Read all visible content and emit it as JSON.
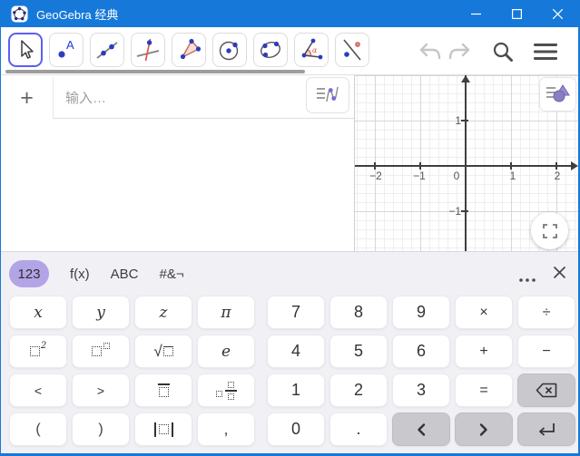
{
  "titlebar": {
    "title": "GeoGebra 经典",
    "icons": [
      "geogebra-logo",
      "minimize",
      "maximize",
      "close"
    ]
  },
  "toolbar": {
    "tools": [
      "move",
      "point",
      "line",
      "perpendicular-line",
      "polygon",
      "circle-with-center",
      "conic-through-points",
      "angle",
      "reflect-about-line"
    ],
    "selected_tool": "move",
    "actions": [
      "undo",
      "redo",
      "search",
      "menu"
    ]
  },
  "algebra": {
    "add_button": "+",
    "input_placeholder": "输入…"
  },
  "graphics": {
    "x_tick_labels": [
      "−2",
      "−1",
      "0",
      "1",
      "2"
    ],
    "y_tick_labels": [
      "1",
      "−1"
    ],
    "buttons": [
      "graphics-style-bar",
      "fullscreen"
    ]
  },
  "keyboard": {
    "tabs": [
      {
        "label": "123",
        "selected": true
      },
      {
        "label": "f(x)",
        "selected": false
      },
      {
        "label": "ABC",
        "selected": false
      },
      {
        "label": "#&¬",
        "selected": false
      }
    ],
    "left": {
      "r1": [
        "x",
        "y",
        "z",
        "π"
      ],
      "e": "e",
      "lt": "<",
      "gt": ">",
      "open_paren": "(",
      "close_paren": ")",
      "comma": ",",
      "sup2": "2",
      "sqrt_sign": "√"
    },
    "numpad": {
      "r1": [
        "7",
        "8",
        "9",
        "×",
        "÷"
      ],
      "r2": [
        "4",
        "5",
        "6",
        "+",
        "−"
      ],
      "r3": [
        "1",
        "2",
        "3",
        "="
      ],
      "r4": [
        "0",
        "."
      ]
    },
    "icon_keys": [
      "square",
      "power",
      "sqrt",
      "recurring-decimal",
      "mixed-number",
      "abs-value",
      "backspace",
      "cursor-left",
      "cursor-right",
      "enter"
    ],
    "header_icons": [
      "more",
      "close-keyboard"
    ]
  },
  "colors": {
    "titlebar": "#1679d9",
    "selected_tool_border": "#5d5fef",
    "tab_pill": "#b2a4e6",
    "action_key_gray": "#c9c8cd",
    "point_blue": "#2a3dc0",
    "accent_red": "#e0534a"
  }
}
